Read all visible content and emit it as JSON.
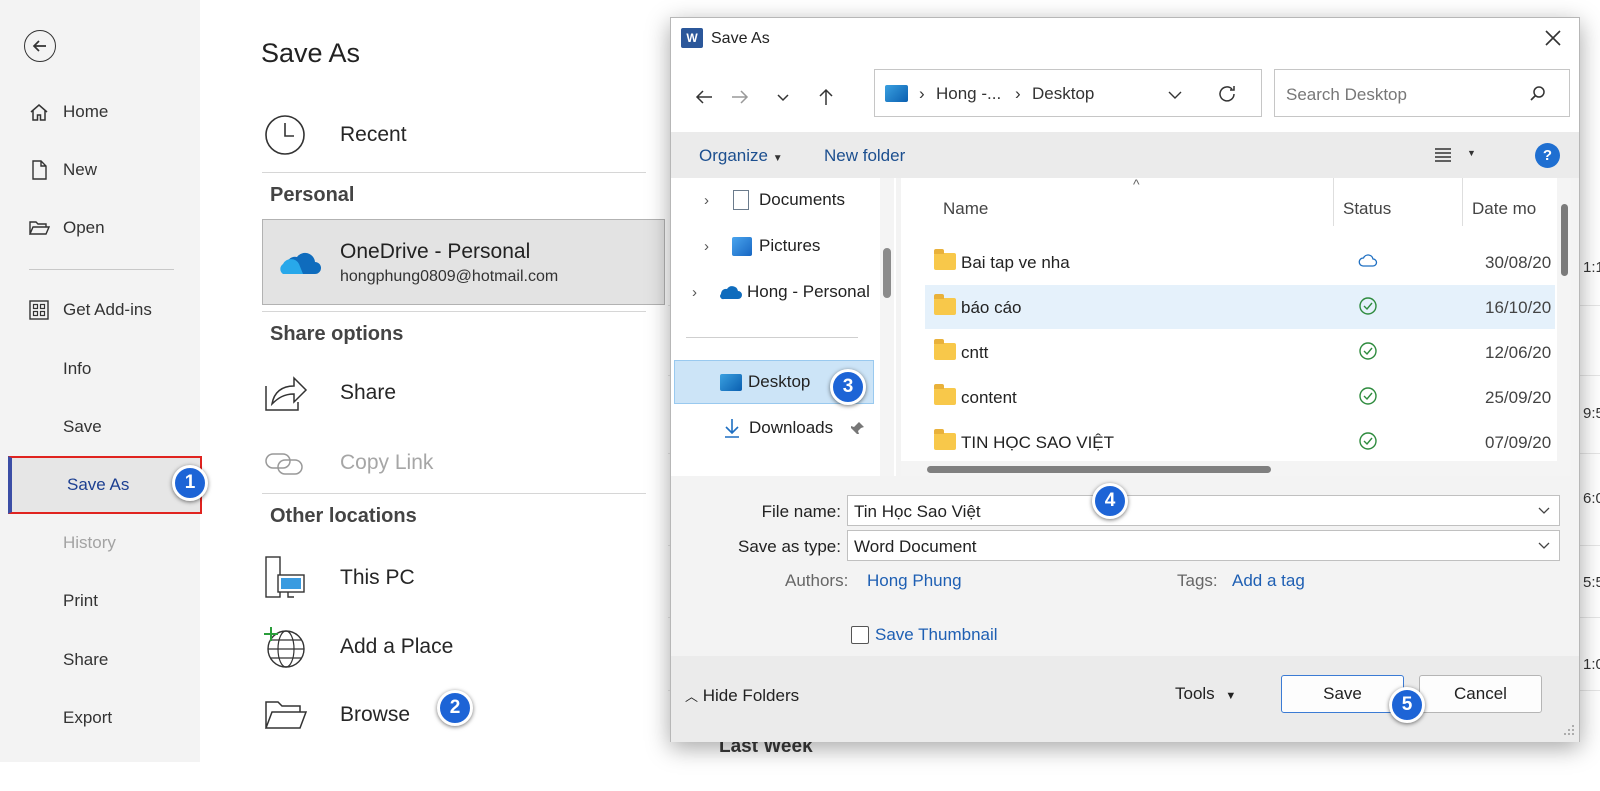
{
  "nav": {
    "items": [
      {
        "label": "Home",
        "icon": "home-icon"
      },
      {
        "label": "New",
        "icon": "new-document-icon"
      },
      {
        "label": "Open",
        "icon": "folder-open-icon"
      },
      {
        "label": "Get Add-ins",
        "icon": "add-ins-grid-icon"
      },
      {
        "label": "Info"
      },
      {
        "label": "Save"
      },
      {
        "label": "Save As",
        "active": true
      },
      {
        "label": "History",
        "disabled": true
      },
      {
        "label": "Print"
      },
      {
        "label": "Share"
      },
      {
        "label": "Export"
      }
    ]
  },
  "panel": {
    "title": "Save As",
    "recent": "Recent",
    "personal_heading": "Personal",
    "onedrive": {
      "name": "OneDrive - Personal",
      "email": "hongphung0809@hotmail.com"
    },
    "share_heading": "Share options",
    "share": "Share",
    "copy_link": "Copy Link",
    "other_heading": "Other locations",
    "this_pc": "This PC",
    "add_place": "Add a Place",
    "browse": "Browse",
    "last_week": "Last Week"
  },
  "background": {
    "times": [
      "1:1",
      "9:5",
      "6:0",
      "5:5",
      "1:0"
    ]
  },
  "dialog": {
    "title": "Save As",
    "address": {
      "segments": [
        "Hong -...",
        "Desktop"
      ]
    },
    "search_placeholder": "Search Desktop",
    "toolbar": {
      "organize": "Organize",
      "new_folder": "New folder",
      "help": "?"
    },
    "tree": [
      {
        "label": "Documents",
        "icon": "documents-icon"
      },
      {
        "label": "Pictures",
        "icon": "pictures-icon"
      },
      {
        "label": "Hong - Personal",
        "icon": "onedrive-cloud-icon"
      },
      {
        "label": "Desktop",
        "icon": "desktop-icon",
        "selected": true
      },
      {
        "label": "Downloads",
        "icon": "download-icon"
      }
    ],
    "columns": {
      "name": "Name",
      "status": "Status",
      "date": "Date mo"
    },
    "files": [
      {
        "name": "Bai tap ve nha",
        "status": "cloud",
        "date": "30/08/20"
      },
      {
        "name": "báo cáo",
        "status": "synced",
        "date": "16/10/20",
        "selected": true
      },
      {
        "name": "cntt",
        "status": "synced",
        "date": "12/06/20"
      },
      {
        "name": "content",
        "status": "synced",
        "date": "25/09/20"
      },
      {
        "name": "TIN HỌC SAO VIỆT",
        "status": "synced",
        "date": "07/09/20"
      }
    ],
    "form": {
      "file_name_label": "File name:",
      "file_name_value": "Tin Học Sao Việt",
      "save_type_label": "Save as type:",
      "save_type_value": "Word Document",
      "authors_label": "Authors:",
      "authors_value": "Hong Phung",
      "tags_label": "Tags:",
      "tags_value": "Add a tag",
      "thumbnail_label": "Save Thumbnail"
    },
    "footer": {
      "hide_folders": "Hide Folders",
      "tools": "Tools",
      "save": "Save",
      "cancel": "Cancel"
    }
  },
  "badges": [
    "1",
    "2",
    "3",
    "4",
    "5"
  ],
  "colors": {
    "accent": "#1d64d6",
    "highlight": "#e0231f",
    "link": "#1e5fb3",
    "selection": "#cce4f7"
  }
}
